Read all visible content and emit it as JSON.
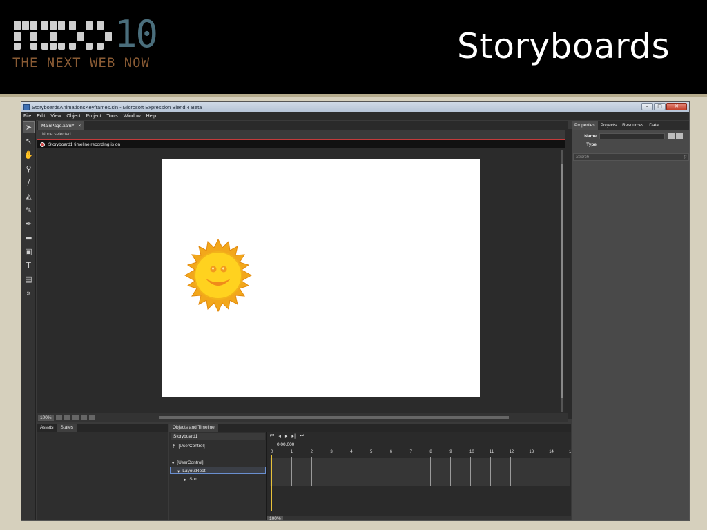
{
  "slide": {
    "logo_number": "10",
    "logo_tagline": "THE NEXT WEB NOW",
    "title": "Storyboards"
  },
  "window": {
    "title": "StoryboardsAnimationsKeyframes.sln - Microsoft Expression Blend 4 Beta"
  },
  "menu": [
    "File",
    "Edit",
    "View",
    "Object",
    "Project",
    "Tools",
    "Window",
    "Help"
  ],
  "document": {
    "tab_label": "MainPage.xaml*",
    "tab_close": "×",
    "breadcrumb": "None selected",
    "recording_text": "Storyboard1 timeline recording is on",
    "zoom": "100%"
  },
  "properties_panel": {
    "tabs": [
      "Properties",
      "Projects",
      "Resources",
      "Data"
    ],
    "name_label": "Name",
    "type_label": "Type",
    "search_placeholder": "Search"
  },
  "left_panel": {
    "tabs": [
      "Assets",
      "States"
    ]
  },
  "objects_timeline": {
    "title": "Objects and Timeline",
    "storyboard": "Storyboard1",
    "scope": "[UserControl]",
    "time": "0:00.000",
    "tree": [
      "[UserControl]",
      "LayoutRoot",
      "Sun"
    ],
    "ruler": [
      "0",
      "1",
      "2",
      "3",
      "4",
      "5",
      "6",
      "7",
      "8",
      "9",
      "10",
      "11",
      "12",
      "13",
      "14",
      "1"
    ],
    "zoom": "100%"
  },
  "colors": {
    "recording_border": "#c43b3b",
    "playhead": "#e8c23a",
    "logo_number": "#4a6e7c",
    "logo_tagline": "#8a5b34"
  }
}
